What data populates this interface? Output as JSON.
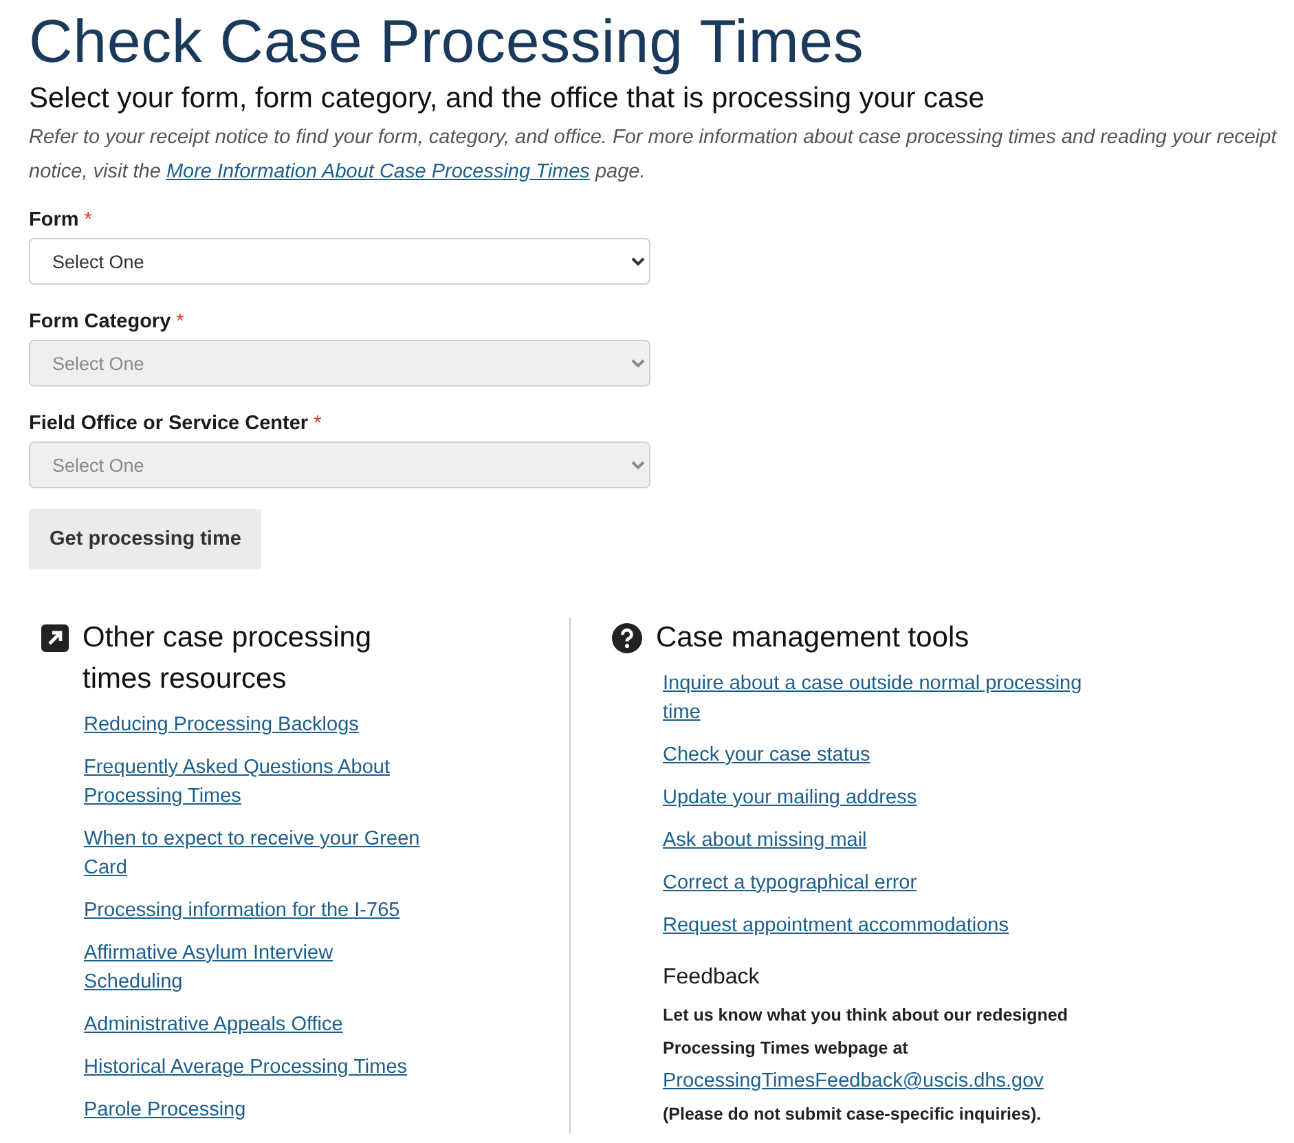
{
  "title": "Check Case Processing Times",
  "subtitle": "Select your form, form category, and the office that is processing your case",
  "intro": {
    "text": "Refer to your receipt notice to find your form, category, and office. For more information about case processing times and reading your receipt notice, visit the ",
    "link": "More Information About Case Processing Times",
    "after": " page."
  },
  "fields": [
    {
      "label": "Form",
      "required_mark": "*",
      "placeholder": "Select One",
      "disabled": false
    },
    {
      "label": "Form Category",
      "required_mark": "*",
      "placeholder": "Select One",
      "disabled": true
    },
    {
      "label": "Field Office or Service Center",
      "required_mark": "*",
      "placeholder": "Select One",
      "disabled": true
    }
  ],
  "submit_button": "Get processing time",
  "resources": {
    "heading": "Other case processing times resources",
    "links": [
      "Reducing Processing Backlogs",
      "Frequently Asked Questions About Processing Times",
      "When to expect to receive your Green Card",
      "Processing information for the I-765",
      "Affirmative Asylum Interview Scheduling",
      "Administrative Appeals Office",
      "Historical Average Processing Times",
      "Parole Processing"
    ]
  },
  "tools": {
    "heading": "Case management tools",
    "links": [
      "Inquire about a case outside normal processing time",
      "Check your case status",
      "Update your mailing address",
      "Ask about missing mail",
      "Correct a typographical error",
      "Request appointment accommodations"
    ]
  },
  "feedback": {
    "heading": "Feedback",
    "text": "Let us know what you think about our redesigned Processing Times webpage at ",
    "email": "ProcessingTimesFeedback@uscis.dhs.gov",
    "after": " (Please do not submit case-specific inquiries)."
  }
}
